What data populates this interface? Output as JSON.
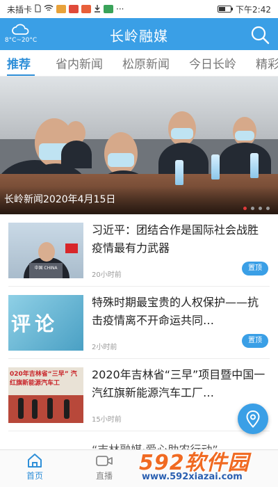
{
  "status_bar": {
    "carrier": "未插卡",
    "time": "下午2:42",
    "battery_level": 0.55,
    "notification_icons": [
      "sim-icon",
      "wifi-icon",
      "news-badge-icon",
      "weibo-badge-icon",
      "app-badge-icon",
      "download-icon",
      "image-icon",
      "more-icon"
    ]
  },
  "header": {
    "title": "长岭融媒",
    "weather": {
      "icon": "cloud-icon",
      "temperature": "8°C~20°C"
    },
    "search_icon": "search-icon"
  },
  "tabs": [
    {
      "label": "推荐",
      "active": true
    },
    {
      "label": "省内新闻"
    },
    {
      "label": "松原新闻"
    },
    {
      "label": "今日长岭"
    },
    {
      "label": "精彩"
    }
  ],
  "banner": {
    "caption": "长岭新闻2020年4月15日",
    "slide_count": 4,
    "active_slide": 1
  },
  "news": [
    {
      "title": "习近平：团结合作是国际社会战胜疫情最有力武器",
      "time": "20小时前",
      "badge": "置顶",
      "thumb_label": "中国 CHINA"
    },
    {
      "title": "特殊时期最宝贵的人权保护——抗击疫情离不开命运共同…",
      "time": "2小时前",
      "badge": "置顶",
      "thumb_label": "评论"
    },
    {
      "title": "2020年吉林省“三早”项目暨中国一汽红旗新能源汽车工厂…",
      "time": "15小时前",
      "badge": "",
      "thumb_label": "020年吉林省“三早” 汽红旗新能源汽车工"
    },
    {
      "title": "“吉林融媒·爱心助农行动”",
      "time": "",
      "badge": ""
    }
  ],
  "bottom_nav": [
    {
      "label": "首页",
      "icon": "home-icon",
      "active": true
    },
    {
      "label": "直播",
      "icon": "video-camera-icon"
    }
  ],
  "fab": {
    "icon": "location-pin-icon"
  },
  "watermark": {
    "brand": "592软件园",
    "url": "www.592xiazai.com"
  },
  "colors": {
    "accent": "#3a9fe6",
    "tab_active": "#2f8fd8",
    "banner_dot_active": "#e03a3a",
    "watermark": "#f06a22"
  }
}
